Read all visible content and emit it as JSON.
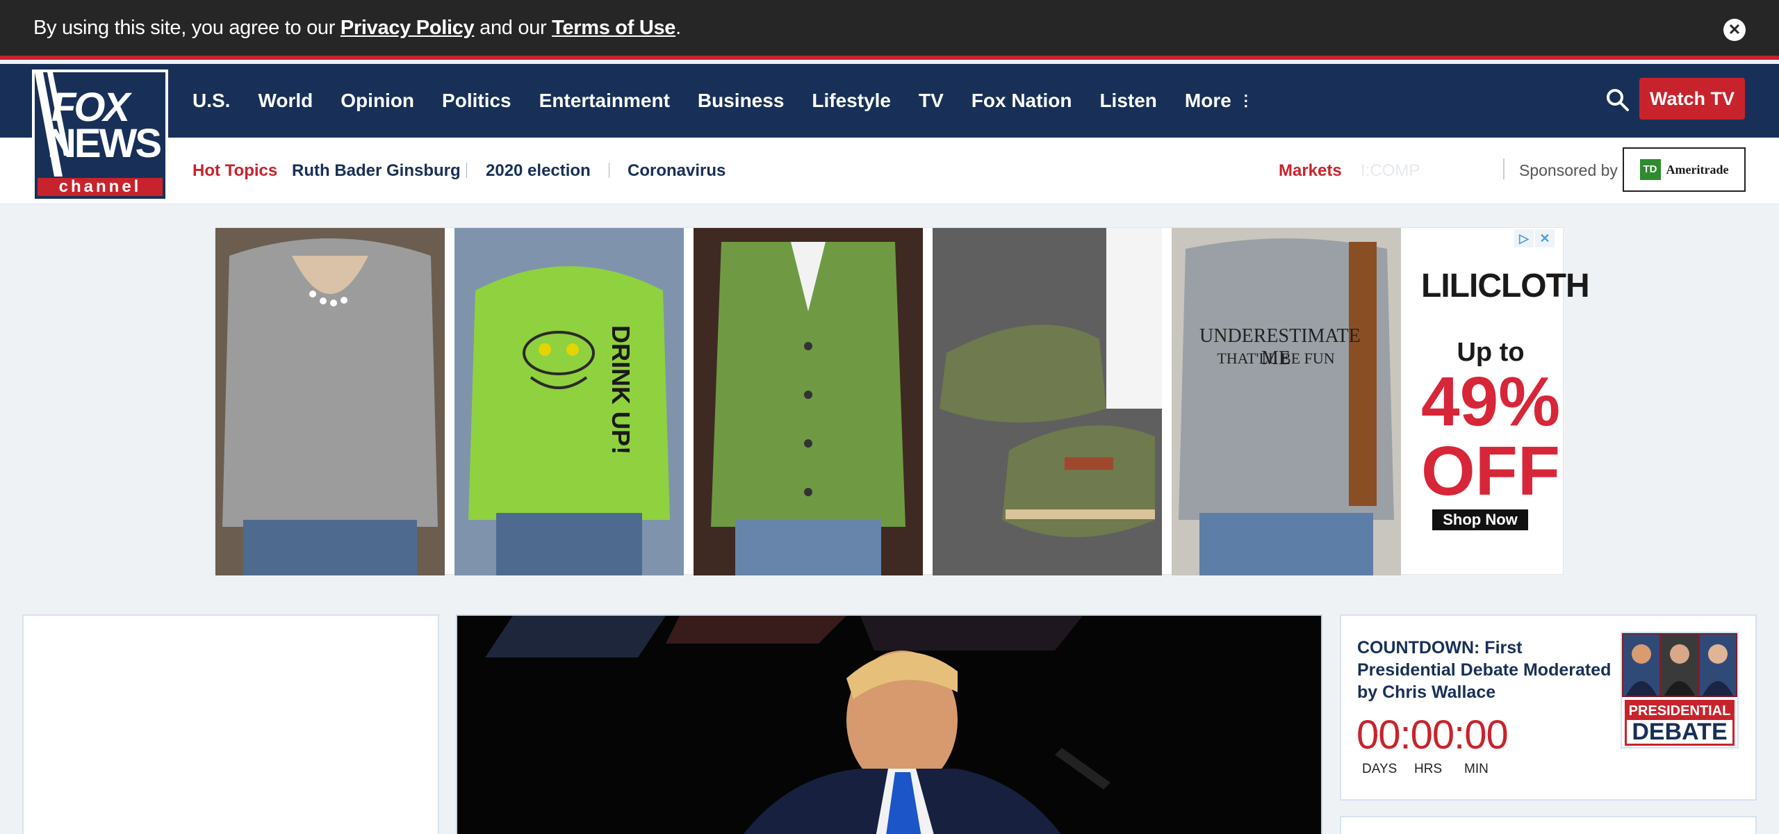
{
  "cookie_bar": {
    "text_pre": "By using this site, you agree to our ",
    "privacy": "Privacy Policy",
    "text_mid": " and our ",
    "terms": "Terms of Use",
    "text_post": ".",
    "close_icon": "close-icon"
  },
  "logo": {
    "line1": "FOX",
    "line2": "NEWS",
    "line3": "channel"
  },
  "nav": {
    "items": [
      "U.S.",
      "World",
      "Opinion",
      "Politics",
      "Entertainment",
      "Business",
      "Lifestyle",
      "TV",
      "Fox Nation",
      "Listen"
    ],
    "more": "More",
    "watch_tv": "Watch TV",
    "search_icon": "search-icon"
  },
  "subnav": {
    "hot_topics": "Hot Topics",
    "topics": [
      "Ruth Bader Ginsburg",
      "2020 election",
      "Coronavirus"
    ],
    "markets": "Markets",
    "ticker": "I:COMP",
    "sponsored_by": "Sponsored by",
    "sponsor": "Ameritrade",
    "sponsor_badge": "TD"
  },
  "ad": {
    "brand": "LILICLOTH",
    "up_to": "Up to",
    "percent": "49%",
    "off": "OFF",
    "cta": "Shop Now",
    "shirt_line1": "UNDERESTIMATE ME",
    "shirt_line2": "THAT'LL BE FUN",
    "hoodie_text": "DRINK UP!"
  },
  "countdown": {
    "title": "COUNTDOWN: First Presidential Debate Moderated by Chris Wallace",
    "time": "00:00:00",
    "units": [
      "DAYS",
      "HRS",
      "MIN"
    ],
    "badge_line1": "PRESIDENTIAL",
    "badge_line2": "DEBATE"
  },
  "colors": {
    "navy": "#183057",
    "red": "#c8232c"
  }
}
